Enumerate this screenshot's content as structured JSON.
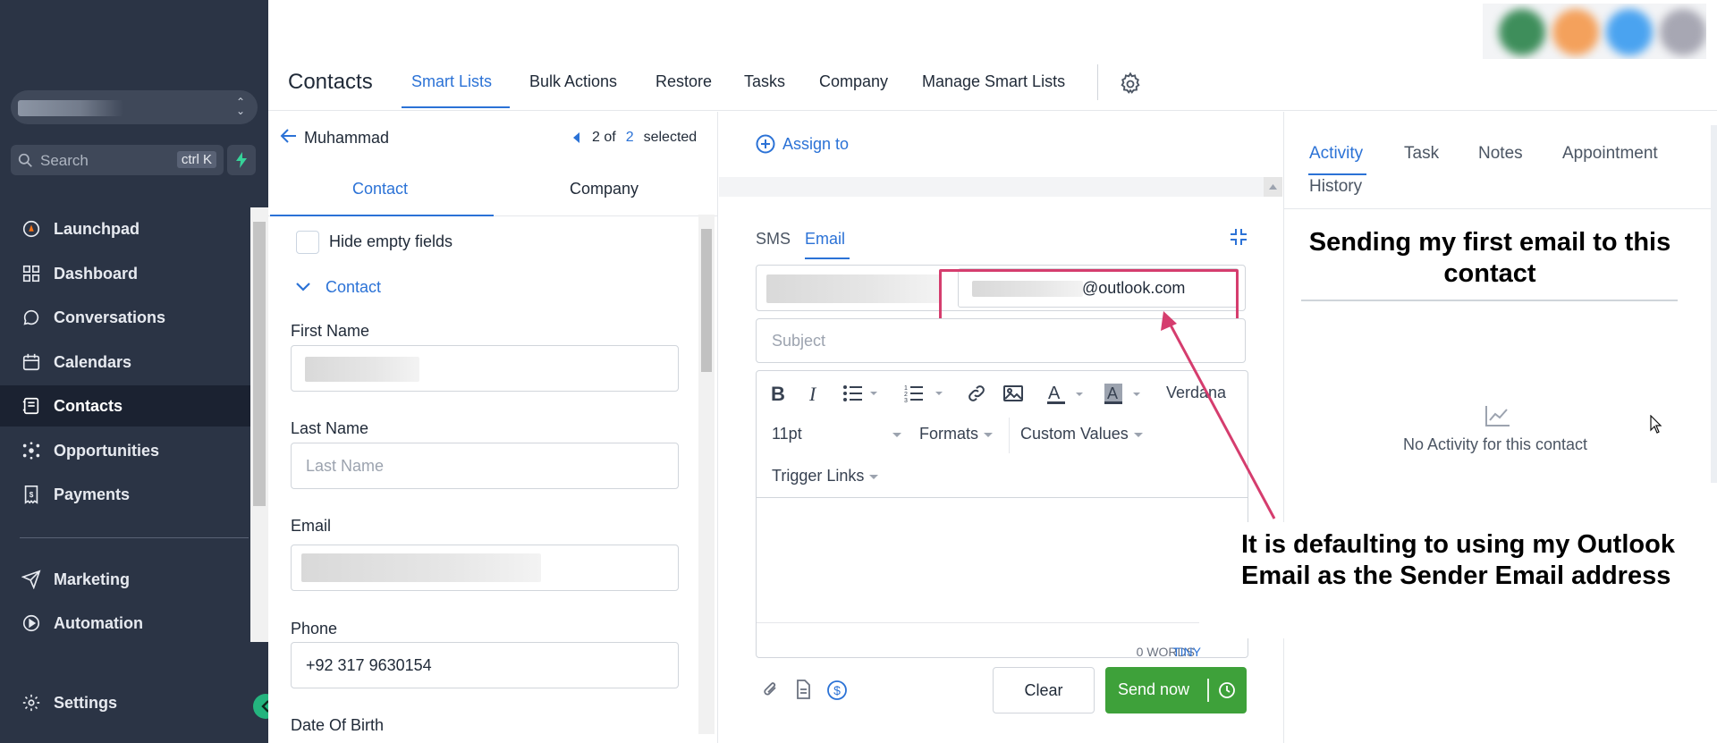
{
  "sidebar": {
    "search_placeholder": "Search",
    "search_shortcut": "ctrl K",
    "items": [
      {
        "label": "Launchpad",
        "icon": "rocket-icon"
      },
      {
        "label": "Dashboard",
        "icon": "dashboard-icon"
      },
      {
        "label": "Conversations",
        "icon": "chat-icon"
      },
      {
        "label": "Calendars",
        "icon": "calendar-icon"
      },
      {
        "label": "Contacts",
        "icon": "contacts-icon",
        "active": true
      },
      {
        "label": "Opportunities",
        "icon": "opportunities-icon"
      },
      {
        "label": "Payments",
        "icon": "payments-icon"
      },
      {
        "label": "Marketing",
        "icon": "send-icon"
      },
      {
        "label": "Automation",
        "icon": "automation-icon"
      },
      {
        "label": "Settings",
        "icon": "gear-icon"
      }
    ]
  },
  "header": {
    "title": "Contacts",
    "tabs": [
      "Smart Lists",
      "Bulk Actions",
      "Restore",
      "Tasks",
      "Company",
      "Manage Smart Lists"
    ],
    "active_tab": "Smart Lists"
  },
  "contact_panel": {
    "name": "Muhammad",
    "pager_pos": "2 of",
    "pager_cur": "2",
    "pager_suffix": "selected",
    "tabs": [
      "Contact",
      "Company"
    ],
    "hide_empty_label": "Hide empty fields",
    "section_title": "Contact",
    "fields": {
      "first_name_label": "First Name",
      "last_name_label": "Last Name",
      "last_name_placeholder": "Last Name",
      "email_label": "Email",
      "phone_label": "Phone",
      "phone_value": "+92 317 9630154",
      "dob_label": "Date Of Birth"
    }
  },
  "compose": {
    "assign_label": "Assign to",
    "tabs": [
      "SMS",
      "Email"
    ],
    "active_tab": "Email",
    "to_suffix": "@outlook.com",
    "subject_placeholder": "Subject",
    "font_family": "Verdana",
    "font_size": "11pt",
    "formats": "Formats",
    "custom_values": "Custom Values",
    "trigger_links": "Trigger Links",
    "status_text": "0 WORDS POWERED BY ",
    "status_brand": "TINY",
    "clear_label": "Clear",
    "send_label": "Send now"
  },
  "activity": {
    "tabs": [
      "Activity",
      "Task",
      "Notes",
      "Appointment",
      "History"
    ],
    "active_tab": "Activity",
    "empty_text": "No Activity for this contact"
  },
  "annotations": {
    "title": "Sending my first email to this contact",
    "note": "It is defaulting to using my Outlook Email as the Sender Email address"
  },
  "colors": {
    "sidebar_bg": "#2b3445",
    "accent": "#2b72d6",
    "send_green": "#3ea13a",
    "highlight_red": "#d53d6e"
  }
}
